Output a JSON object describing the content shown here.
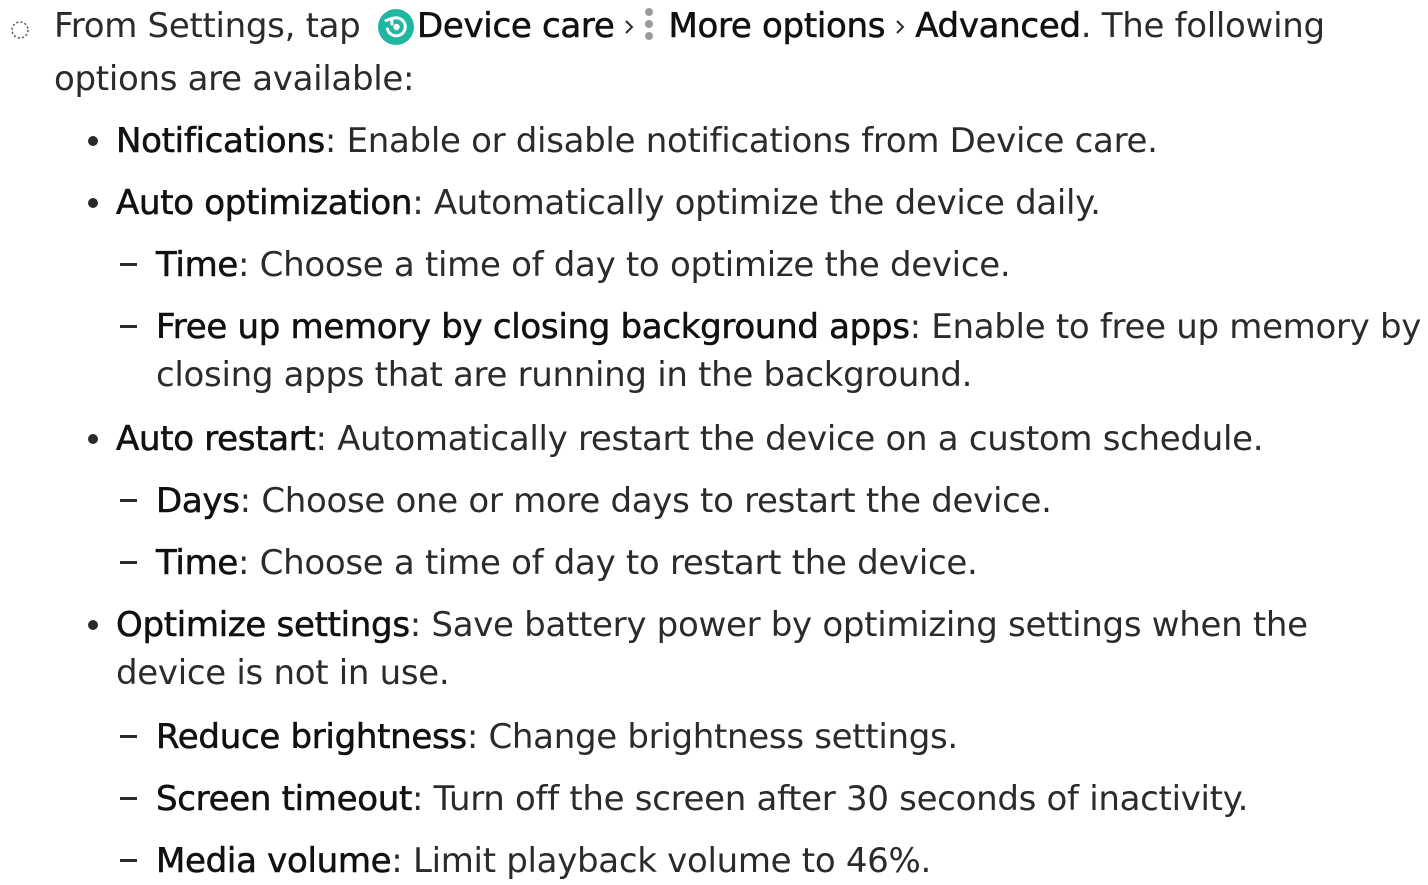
{
  "step": {
    "text_before": "From Settings, tap",
    "device_care": "Device care",
    "more_options": "More options",
    "advanced": "Advanced",
    "text_after_1": ". The following",
    "text_line2": "options are available:",
    "device_care_icon_color": "#1fb7a2"
  },
  "items": [
    {
      "term": "Notifications",
      "desc": ": Enable or disable notifications from Device care."
    },
    {
      "term": "Auto optimization",
      "desc": ": Automatically optimize the device daily."
    },
    {
      "term": "Time",
      "desc": ": Choose a time of day to optimize the device."
    },
    {
      "term": "Free up memory by closing background apps",
      "desc": ": Enable to free up memory by",
      "desc2": "closing apps that are running in the background."
    },
    {
      "term": "Auto restart",
      "desc": ": Automatically restart the device on a custom schedule."
    },
    {
      "term": "Days",
      "desc": ": Choose one or more days to restart the device."
    },
    {
      "term": "Time",
      "desc": ": Choose a time of day to restart the device."
    },
    {
      "term": "Optimize settings",
      "desc": ": Save battery power by optimizing settings when the",
      "desc2": "device is not in use."
    },
    {
      "term": "Reduce brightness",
      "desc": ": Change brightness settings."
    },
    {
      "term": "Screen timeout",
      "desc": ": Turn off the screen after 30 seconds of inactivity."
    },
    {
      "term": "Media volume",
      "desc": ": Limit playback volume to 46%."
    }
  ]
}
